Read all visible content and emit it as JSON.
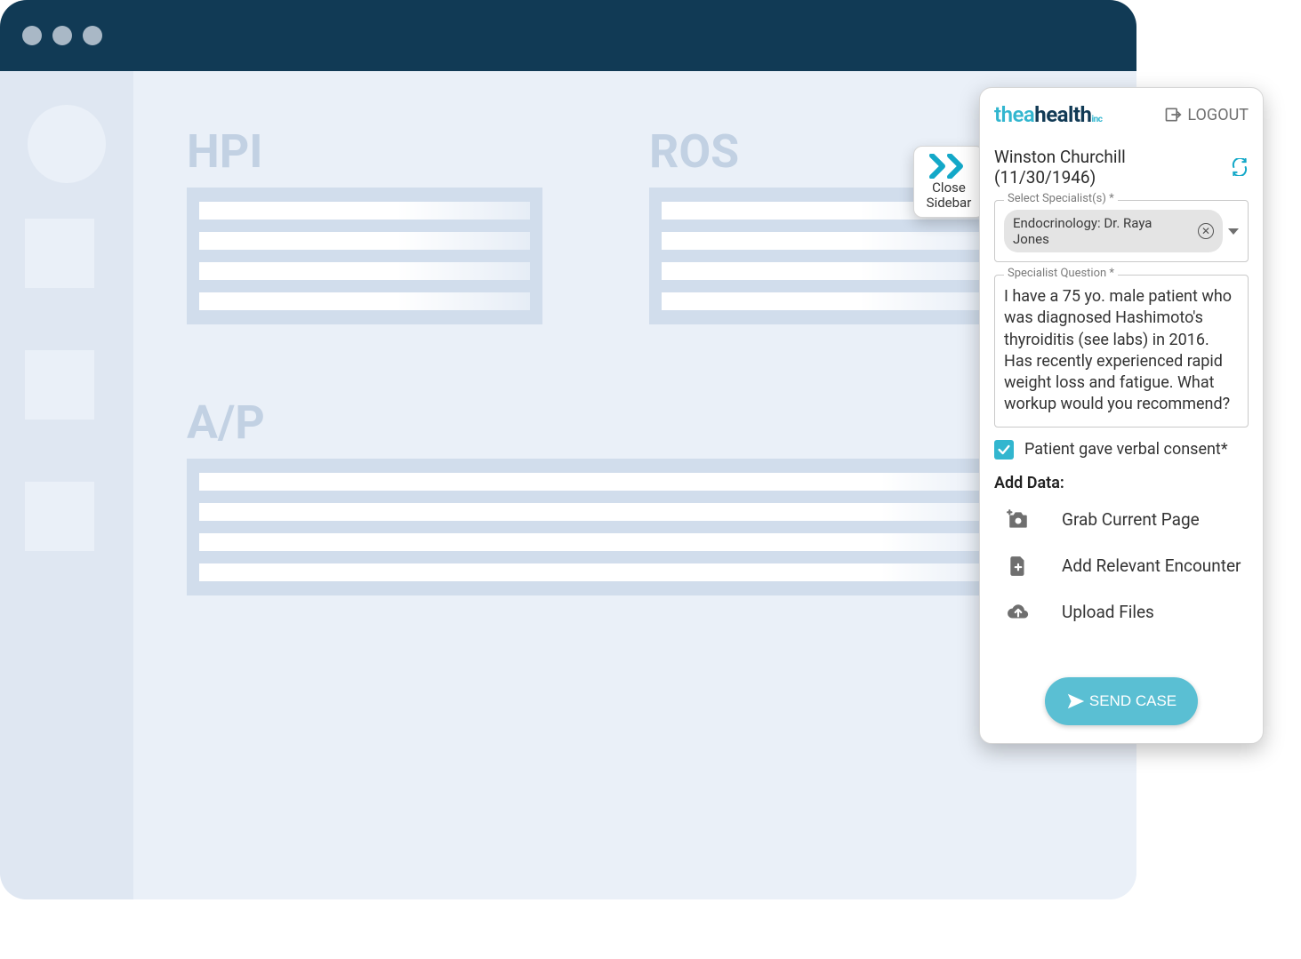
{
  "logo": {
    "part1": "thea",
    "part2": "health",
    "suffix": "inc"
  },
  "logout_label": "LOGOUT",
  "patient": {
    "display": "Winston Churchill (11/30/1946)"
  },
  "close_sidebar": {
    "line1": "Close",
    "line2": "Sidebar"
  },
  "specialist_field": {
    "label": "Select Specialist(s) *",
    "chip": "Endocrinology: Dr. Raya Jones"
  },
  "question_field": {
    "label": "Specialist Question *",
    "value": "I have a 75 yo. male patient who was diagnosed Hashimoto's thyroiditis (see labs) in 2016. Has recently experienced rapid weight loss and fatigue. What workup would you recommend?"
  },
  "consent": {
    "checked": true,
    "label": "Patient gave verbal consent*"
  },
  "add_data_label": "Add Data:",
  "actions": {
    "grab": "Grab Current Page",
    "encounter": "Add Relevant Encounter",
    "upload": "Upload Files"
  },
  "send_label": "SEND CASE",
  "emr_sections": {
    "hpi": "HPI",
    "ros": "ROS",
    "ap": "A/P"
  }
}
